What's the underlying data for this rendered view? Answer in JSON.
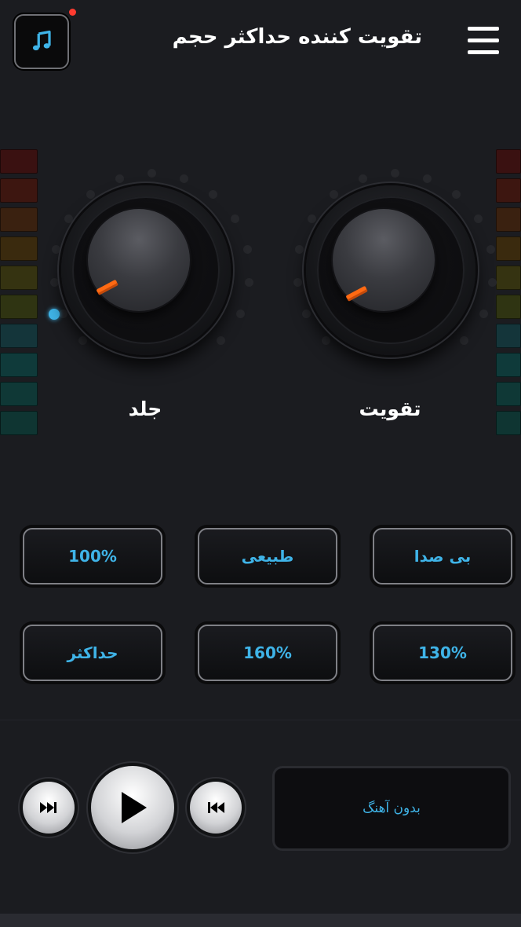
{
  "header": {
    "title": "تقویت کننده حداکثر حجم",
    "music_icon": "music-note-icon",
    "menu_icon": "hamburger-menu-icon"
  },
  "knobs": {
    "left_label": "جلد",
    "right_label": "تقویت"
  },
  "presets": [
    {
      "label": "100%"
    },
    {
      "label": "طبیعی"
    },
    {
      "label": "بی صدا"
    },
    {
      "label": "حداکثر"
    },
    {
      "label": "160%"
    },
    {
      "label": "130%"
    }
  ],
  "player": {
    "track_name": "بدون آهنگ",
    "controls": [
      "fast-forward-icon",
      "play-icon",
      "rewind-icon"
    ]
  },
  "colors": {
    "accent": "#3fb4e8",
    "knob_marker": "#ff6a13",
    "notification_dot": "#ff3b30",
    "background": "#1b1c20"
  }
}
